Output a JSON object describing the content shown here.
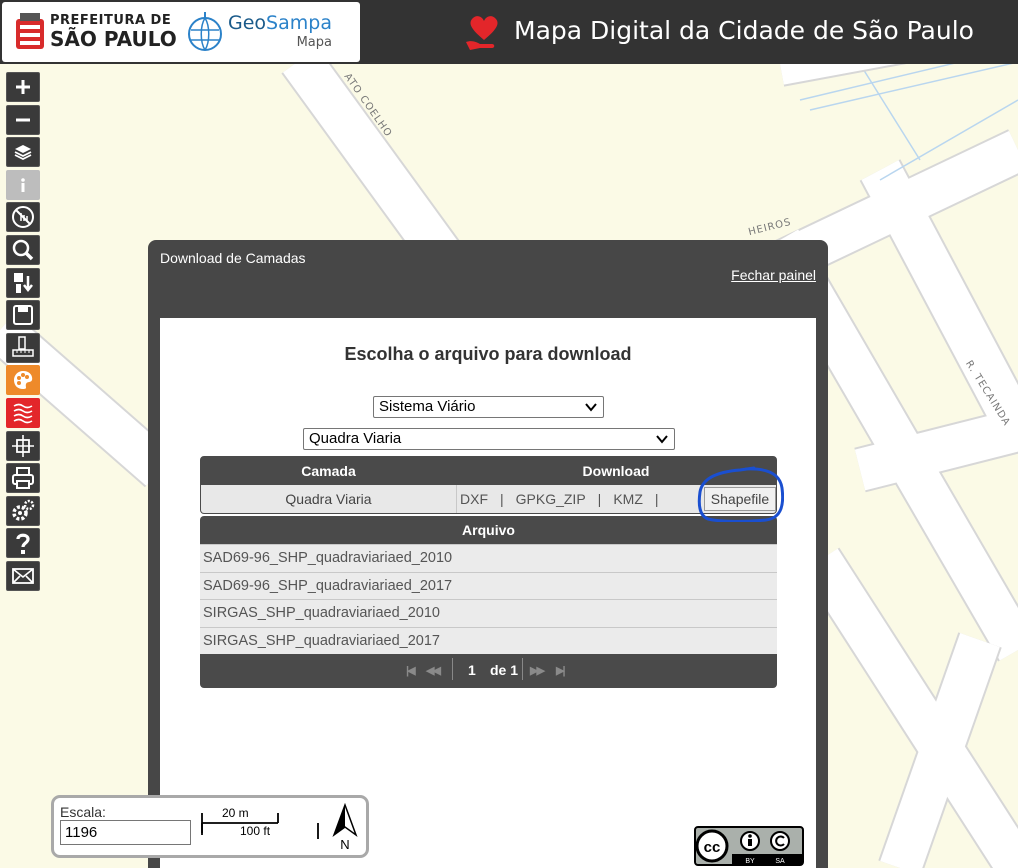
{
  "header": {
    "pref_line1": "PREFEITURA DE",
    "pref_line2": "SÃO PAULO",
    "geo_part1": "Geo",
    "geo_part2": "Sampa",
    "geo_sub": "Mapa",
    "title": "Mapa Digital da Cidade de São Paulo"
  },
  "map": {
    "street_labels": [
      "ATO COELHO",
      "HEIROS",
      "R. TECAINDA"
    ]
  },
  "toolbar": {
    "tools": [
      {
        "icon": "zoom-in-icon"
      },
      {
        "icon": "zoom-out-icon"
      },
      {
        "icon": "layers-icon"
      },
      {
        "icon": "info-icon",
        "state": "disabled"
      },
      {
        "icon": "no-touch-icon"
      },
      {
        "icon": "search-icon"
      },
      {
        "icon": "tree-download-icon"
      },
      {
        "icon": "save-icon"
      },
      {
        "icon": "measure-icon"
      },
      {
        "icon": "palette-icon",
        "color": "#ee8a2a"
      },
      {
        "icon": "contour-icon",
        "color": "#e3262a"
      },
      {
        "icon": "crosshair-icon"
      },
      {
        "icon": "print-icon"
      },
      {
        "icon": "settings-icon"
      },
      {
        "icon": "help-icon"
      },
      {
        "icon": "mail-icon"
      }
    ]
  },
  "panel": {
    "title": "Download de Camadas",
    "close_label": "Fechar painel",
    "heading": "Escolha o arquivo para download",
    "select_group": "Sistema Viário",
    "select_layer": "Quadra Viaria",
    "download_table": {
      "headers": [
        "Camada",
        "Download"
      ],
      "row": {
        "layer": "Quadra Viaria",
        "formats": [
          "DXF",
          "GPKG_ZIP",
          "KMZ"
        ],
        "separator": "|",
        "shapefile": "Shapefile"
      }
    },
    "files_table": {
      "header": "Arquivo",
      "rows": [
        "SAD69-96_SHP_quadraviariaed_2010",
        "SAD69-96_SHP_quadraviariaed_2017",
        "SIRGAS_SHP_quadraviariaed_2010",
        "SIRGAS_SHP_quadraviariaed_2017"
      ],
      "pager": {
        "current": "1",
        "of_label": "de 1"
      }
    }
  },
  "scale": {
    "label": "Escala:",
    "value": "1196",
    "bar_metric": "20 m",
    "bar_imperial": "100 ft",
    "north": "N"
  },
  "license": {
    "by": "BY",
    "sa": "SA"
  },
  "colors": {
    "header_bg": "#333333",
    "panel_bg": "#474747",
    "map_bg": "#fbfae6",
    "highlight": "#1a4fd0",
    "heart": "#e3262a"
  }
}
